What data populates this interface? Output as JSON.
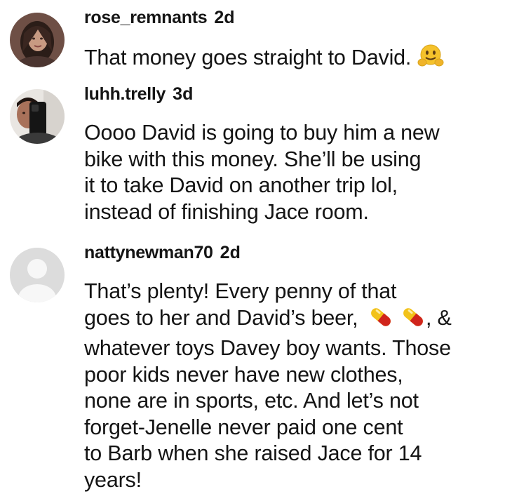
{
  "comments": [
    {
      "username": "rose_remnants",
      "time": "2d",
      "lines": [
        "That money goes straight to David."
      ],
      "avatar_icon": "profile-photo",
      "emoji_icon": "hugging-face-emoji"
    },
    {
      "username": "luhh.trelly",
      "time": "3d",
      "lines": [
        "Oooo David is going to buy him a new",
        "bike with this money. She’ll be using",
        "it to take David on another trip lol,",
        "instead of finishing Jace room."
      ],
      "avatar_icon": "profile-photo"
    },
    {
      "username": "nattynewman70",
      "time": "2d",
      "lines": [
        "That’s plenty! Every penny of that",
        "goes to her and David’s beer,",
        "whatever toys Davey boy wants. Those",
        "poor kids never have new clothes,",
        "none are in sports, etc. And let’s not",
        "forget-Jenelle never paid one cent",
        "to Barb when she raised Jace for 14",
        "years!"
      ],
      "line2_suffix": ", &",
      "avatar_icon": "default-avatar",
      "pill_icon": "pill-emoji"
    }
  ],
  "colors": {
    "text": "#141414",
    "pill_red": "#d0241c",
    "pill_yellow": "#f2c21a",
    "emoji_yellow": "#f5c22b",
    "default_avatar_bg": "#dcdcdc"
  }
}
